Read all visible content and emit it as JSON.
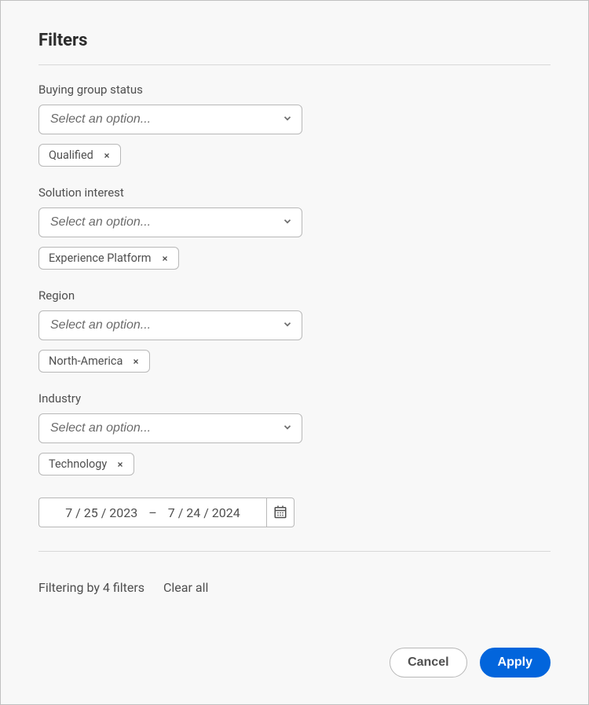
{
  "title": "Filters",
  "filters": {
    "buying_group_status": {
      "label": "Buying group status",
      "placeholder": "Select an option...",
      "tags": [
        "Qualified"
      ]
    },
    "solution_interest": {
      "label": "Solution interest",
      "placeholder": "Select an option...",
      "tags": [
        "Experience Platform"
      ]
    },
    "region": {
      "label": "Region",
      "placeholder": "Select an option...",
      "tags": [
        "North-America"
      ]
    },
    "industry": {
      "label": "Industry",
      "placeholder": "Select an option...",
      "tags": [
        "Technology"
      ]
    }
  },
  "date_range": {
    "start": "7 / 25 / 2023",
    "dash": "–",
    "end": "7 / 24 / 2024"
  },
  "status": {
    "text": "Filtering by 4 filters",
    "clear": "Clear all"
  },
  "buttons": {
    "cancel": "Cancel",
    "apply": "Apply"
  },
  "icons": {
    "chevron_down": "chevron-down-icon",
    "close": "close-icon",
    "calendar": "calendar-icon"
  }
}
